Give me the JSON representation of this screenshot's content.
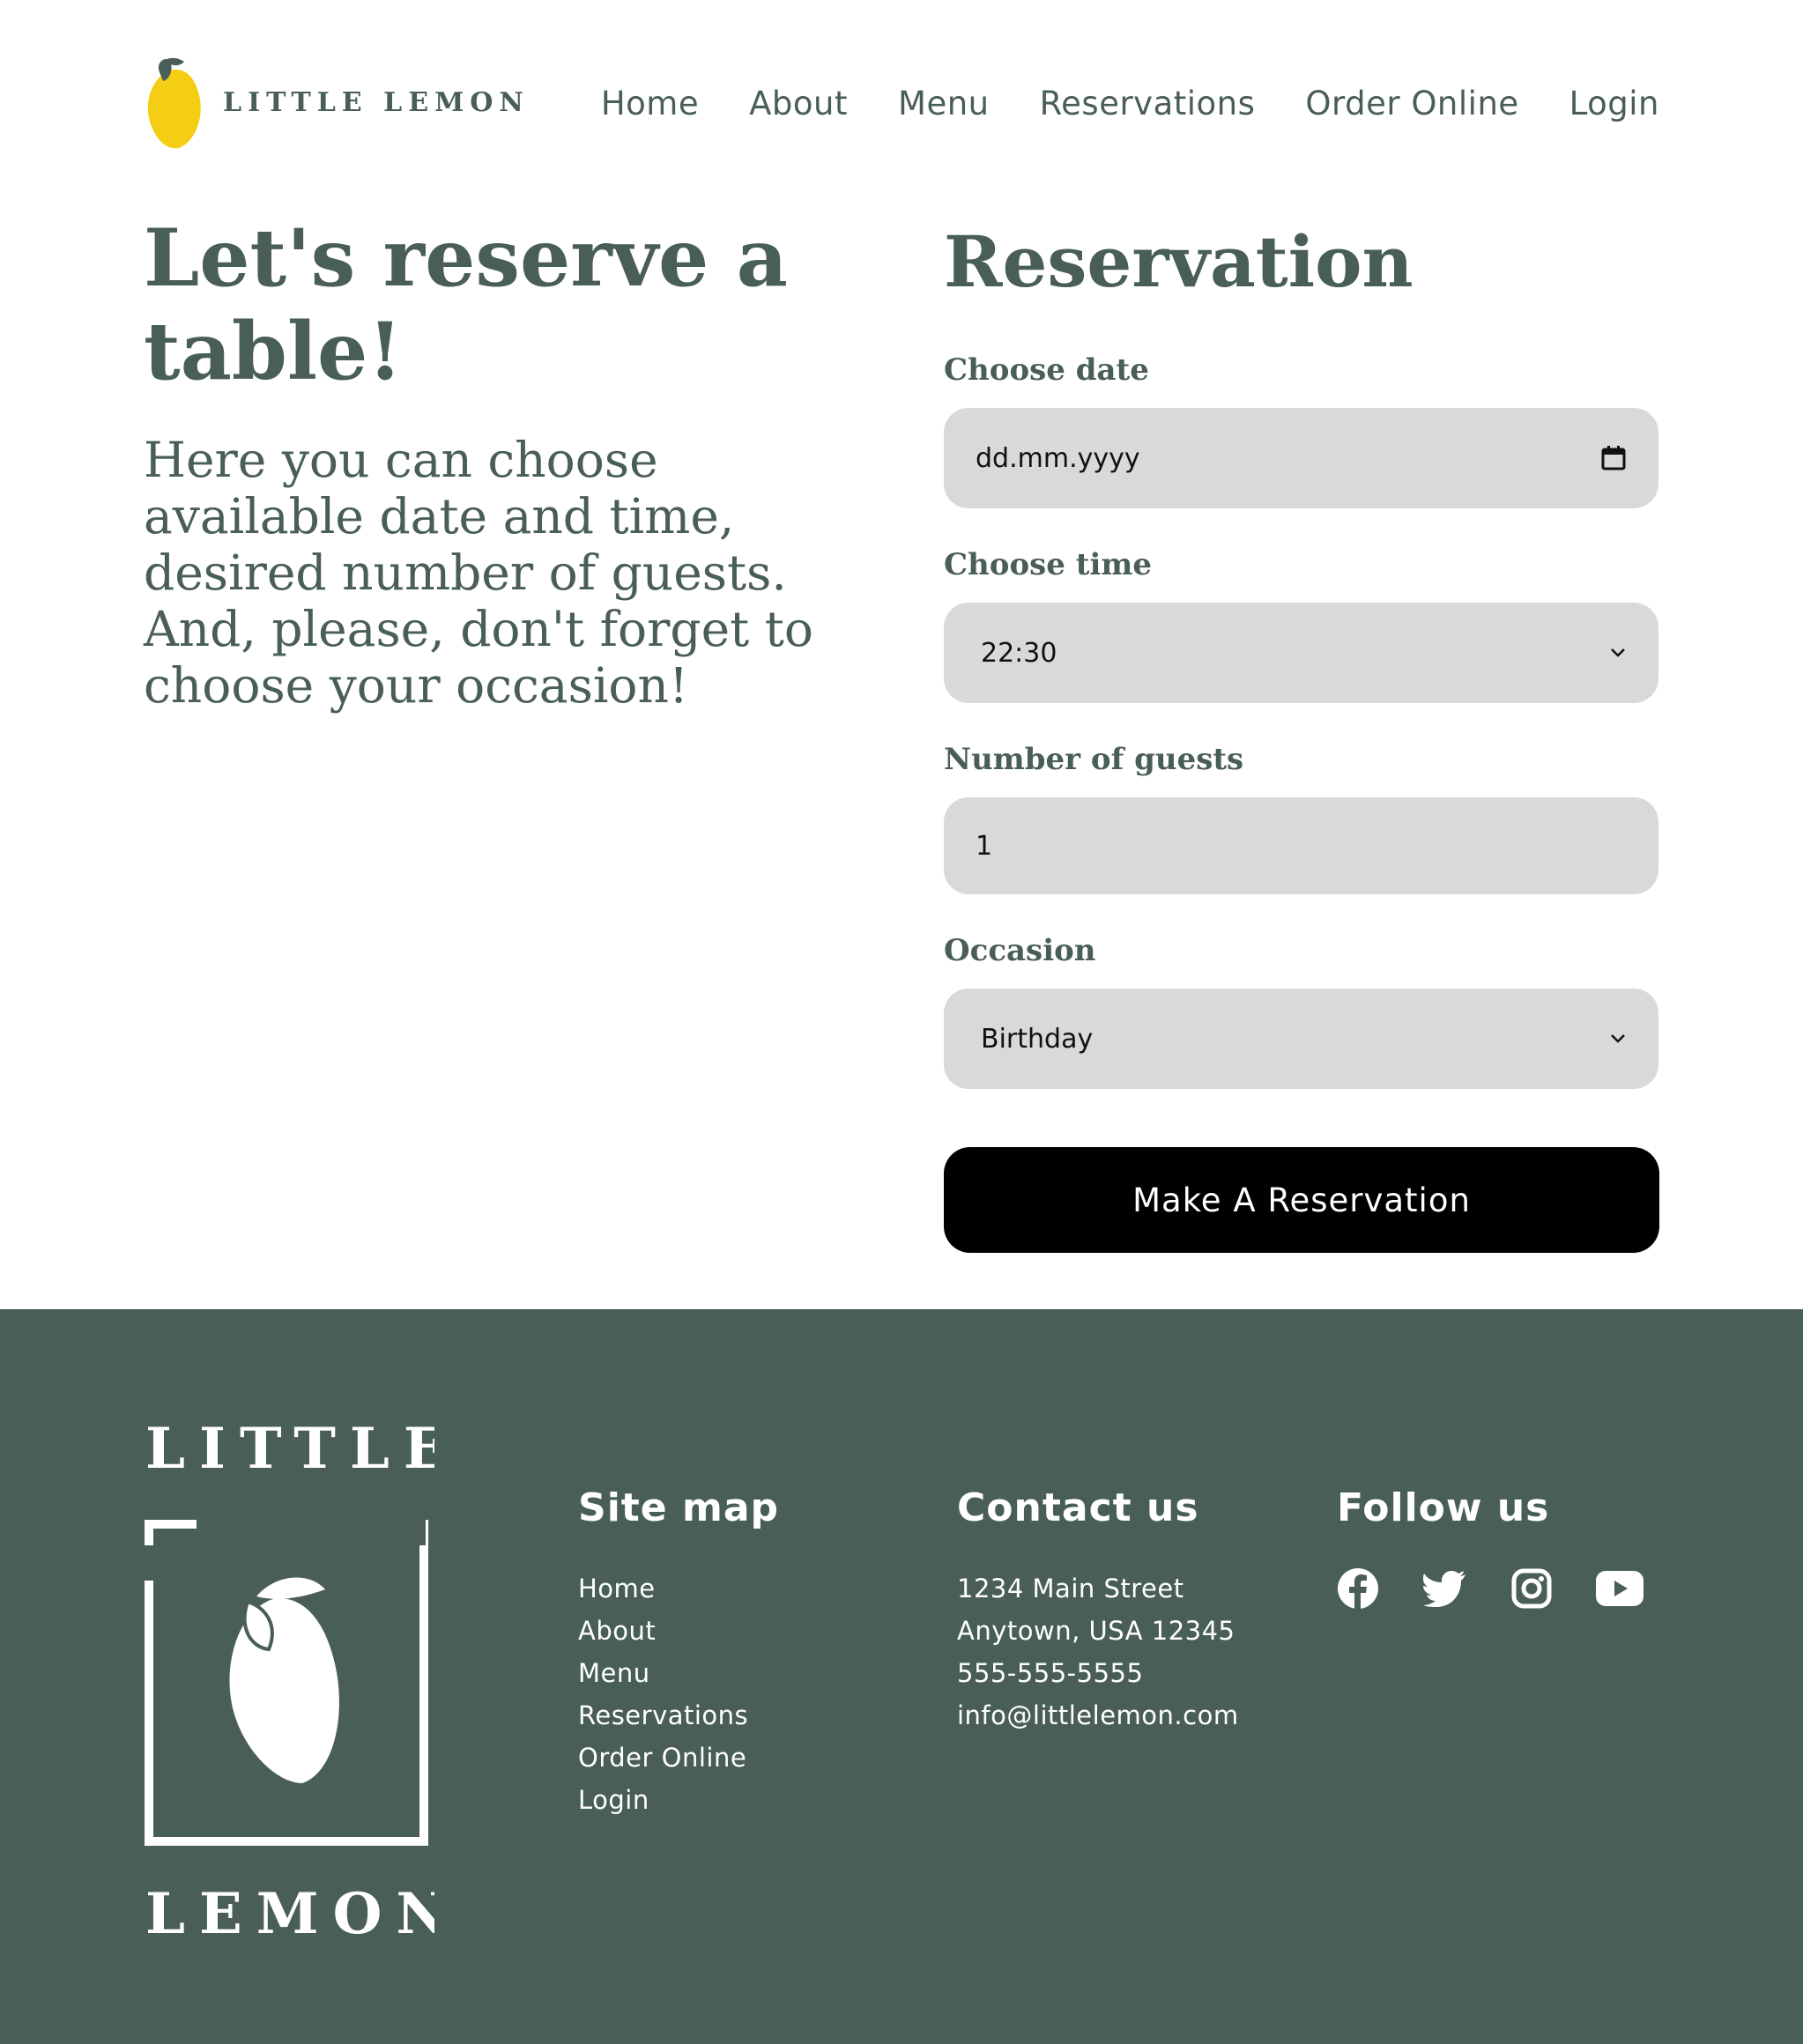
{
  "header": {
    "brand": "LITTLE LEMON",
    "nav": [
      "Home",
      "About",
      "Menu",
      "Reservations",
      "Order Online",
      "Login"
    ]
  },
  "intro": {
    "title": "Let's reserve a table!",
    "text": "Here you can choose available date and time, desired number of guests. And, please, don't forget to choose your occasion!"
  },
  "form": {
    "title": "Reservation",
    "date_label": "Choose date",
    "date_value": "dd.mm.yyyy",
    "time_label": "Choose time",
    "time_value": "22:30",
    "guests_label": "Number of guests",
    "guests_value": "1",
    "occasion_label": "Occasion",
    "occasion_value": "Birthday",
    "submit_label": "Make A Reservation"
  },
  "footer": {
    "logo_top": "LITTLE",
    "logo_bottom": "LEMON",
    "sitemap_title": "Site map",
    "sitemap": [
      "Home",
      "About",
      "Menu",
      "Reservations",
      "Order Online",
      "Login"
    ],
    "contact_title": "Contact us",
    "contact": [
      "1234 Main Street",
      "Anytown, USA 12345",
      "555-555-5555",
      "info@littlelemon.com"
    ],
    "follow_title": "Follow us",
    "social_icons": [
      "facebook-icon",
      "twitter-icon",
      "instagram-icon",
      "youtube-icon"
    ]
  },
  "colors": {
    "primary_green": "#495e57",
    "field_gray": "#d9d9d9",
    "lemon_yellow": "#f4ce14",
    "button_black": "#000000"
  }
}
